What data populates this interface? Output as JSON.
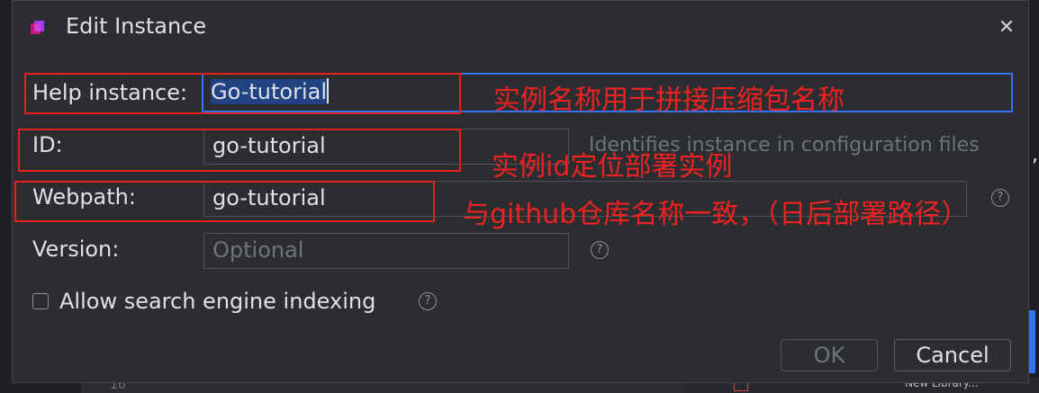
{
  "dialog": {
    "title": "Edit Instance",
    "close_glyph": "✕",
    "icon": "ide-writerside-icon"
  },
  "form": {
    "help_instance": {
      "label": "Help instance:",
      "value": "Go-tutorial"
    },
    "id": {
      "label": "ID:",
      "value": "go-tutorial",
      "hint": "Identifies instance in configuration files"
    },
    "webpath": {
      "label": "Webpath:",
      "value": "go-tutorial"
    },
    "version": {
      "label": "Version:",
      "placeholder": "Optional"
    },
    "indexing": {
      "label": "Allow search engine indexing",
      "checked": false
    }
  },
  "help_glyph": "?",
  "buttons": {
    "ok": "OK",
    "cancel": "Cancel"
  },
  "annotations": {
    "name_note": "实例名称用于拼接压缩包名称",
    "id_note": "实例id定位部署实例",
    "webpath_note": "与github仓库名称一致，（日后部署路径）"
  },
  "background": {
    "line_number": "16",
    "library_label": "New Library..."
  },
  "colors": {
    "accent": "#3574f0",
    "annotation": "#e52020",
    "dialog_bg": "#2b2d30",
    "text": "#dfe1e5"
  }
}
